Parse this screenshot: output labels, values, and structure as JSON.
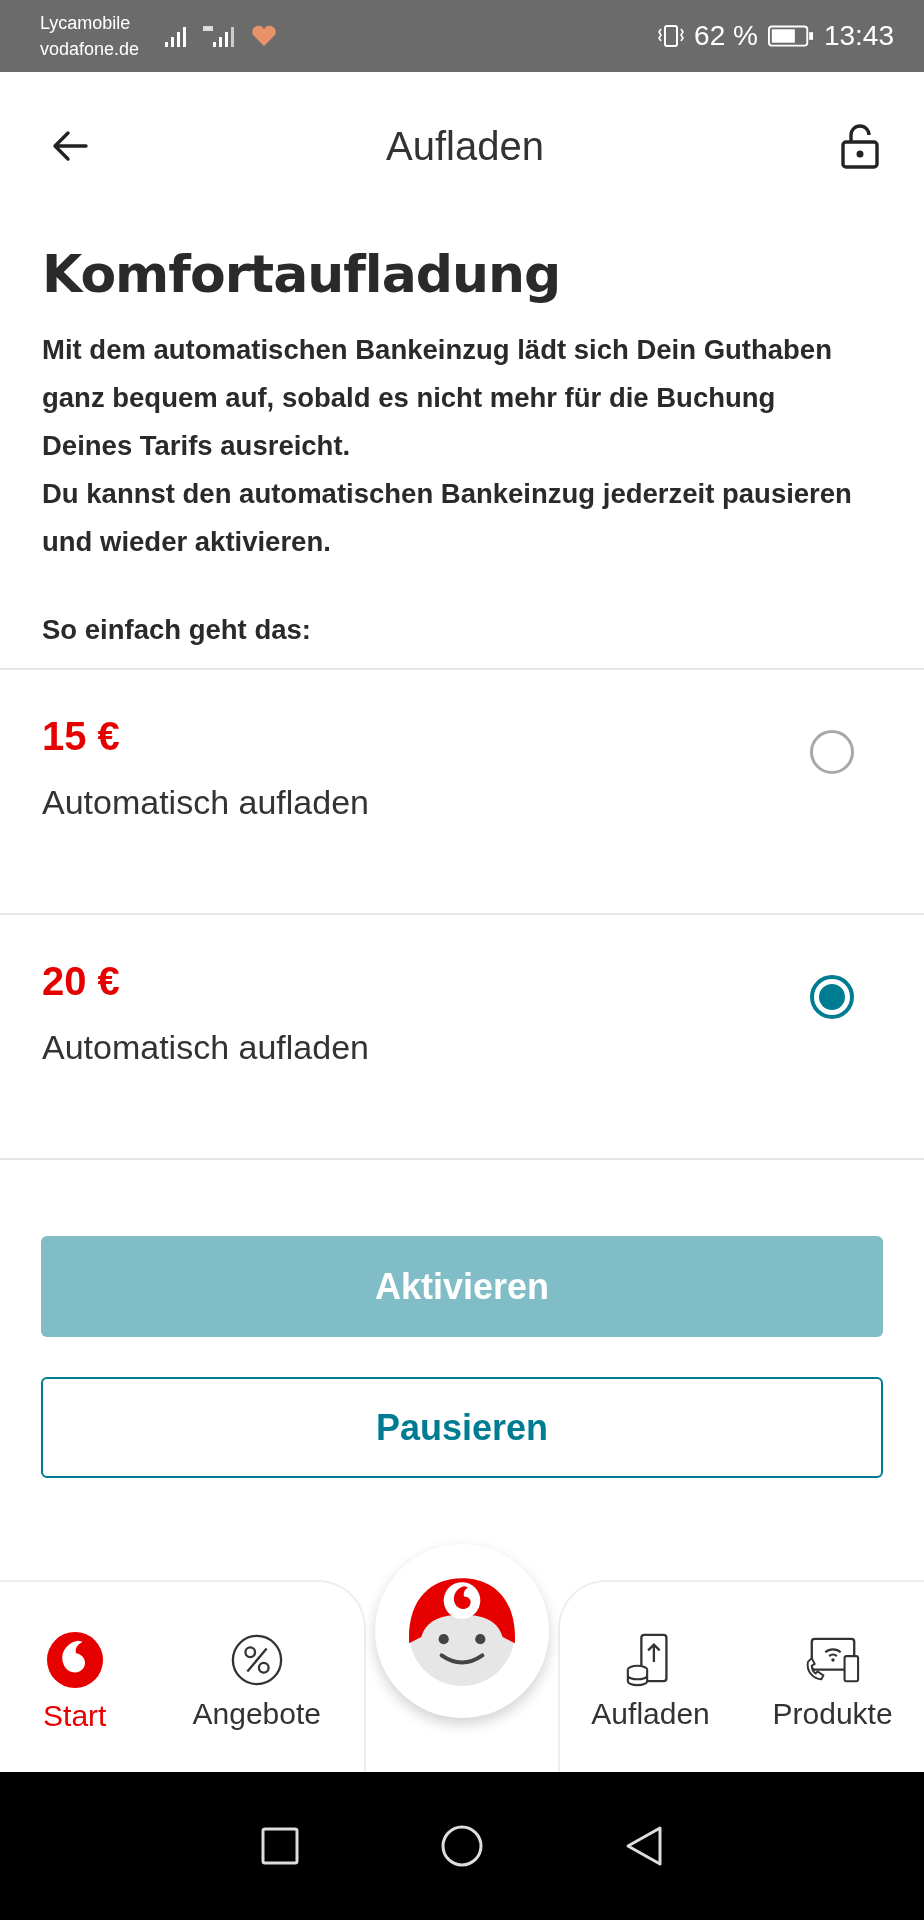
{
  "status_bar": {
    "carrier": [
      "Lycamobile",
      "vodafone.de"
    ],
    "battery": "62 %",
    "time": "13:43"
  },
  "header": {
    "title": "Aufladen"
  },
  "heading": "Komfortaufladung",
  "paragraphs": [
    "Mit dem automatischen Bankeinzug lädt sich Dein Guthaben ganz bequem auf, sobald es nicht mehr für die Buchung Deines Tarifs ausreicht.",
    "Du kannst den automatischen Bankeinzug jederzeit pausieren und wieder aktivieren."
  ],
  "steps_label": "So einfach geht das:",
  "options": [
    {
      "amount": "15 €",
      "label": "Automatisch aufladen",
      "selected": false
    },
    {
      "amount": "20 €",
      "label": "Automatisch aufladen",
      "selected": true
    }
  ],
  "buttons": [
    {
      "label": "Aktivieren",
      "kind": "primary",
      "disabled": true
    },
    {
      "label": "Pausieren",
      "kind": "outline",
      "disabled": false
    }
  ],
  "nav": [
    {
      "label": "Start",
      "selected": true
    },
    {
      "label": "Angebote",
      "selected": false
    },
    {
      "label": "Aufladen",
      "selected": false
    },
    {
      "label": "Produkte",
      "selected": false
    }
  ]
}
